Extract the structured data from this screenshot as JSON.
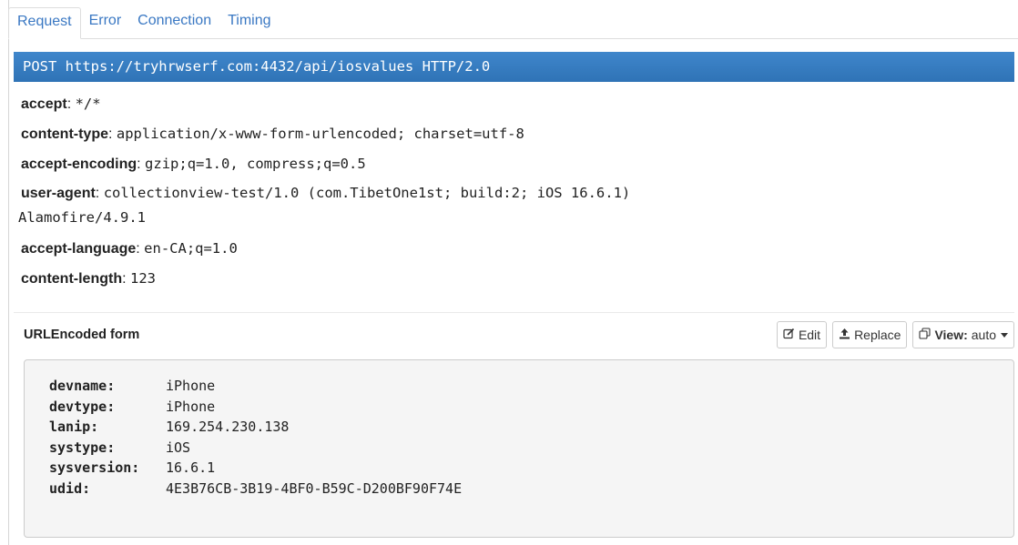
{
  "tabs": [
    {
      "label": "Request",
      "active": true
    },
    {
      "label": "Error",
      "active": false
    },
    {
      "label": "Connection",
      "active": false
    },
    {
      "label": "Timing",
      "active": false
    }
  ],
  "request_line": "POST https://tryhrwserf.com:4432/api/iosvalues HTTP/2.0",
  "headers": [
    {
      "name": "accept",
      "value": "*/*"
    },
    {
      "name": "content-type",
      "value": "application/x-www-form-urlencoded; charset=utf-8"
    },
    {
      "name": "accept-encoding",
      "value": "gzip;q=1.0, compress;q=0.5"
    },
    {
      "name": "user-agent",
      "value": "collectionview-test/1.0 (com.TibetOne1st; build:2; iOS 16.6.1)",
      "value_line2": "Alamofire/4.9.1"
    },
    {
      "name": "accept-language",
      "value": "en-CA;q=1.0"
    },
    {
      "name": "content-length",
      "value": "123"
    }
  ],
  "form_section": {
    "title": "URLEncoded form",
    "edit_label": "Edit",
    "replace_label": "Replace",
    "view_label": "View:",
    "view_value": "auto"
  },
  "form_fields": [
    {
      "key": "devname:",
      "value": "iPhone"
    },
    {
      "key": "devtype:",
      "value": "iPhone"
    },
    {
      "key": "lanip:",
      "value": "169.254.230.138"
    },
    {
      "key": "systype:",
      "value": "iOS"
    },
    {
      "key": "sysversion:",
      "value": "16.6.1"
    },
    {
      "key": "udid:",
      "value": "4E3B76CB-3B19-4BF0-B59C-D200BF90F74E"
    }
  ],
  "icons": {
    "edit": "pencil-square-icon",
    "replace": "upload-icon",
    "view": "copy-icon",
    "dropdown": "caret-down-icon"
  },
  "colors": {
    "tab_link": "#3a78c3",
    "request_bar": "#357abd",
    "form_bg": "#f5f5f5"
  }
}
